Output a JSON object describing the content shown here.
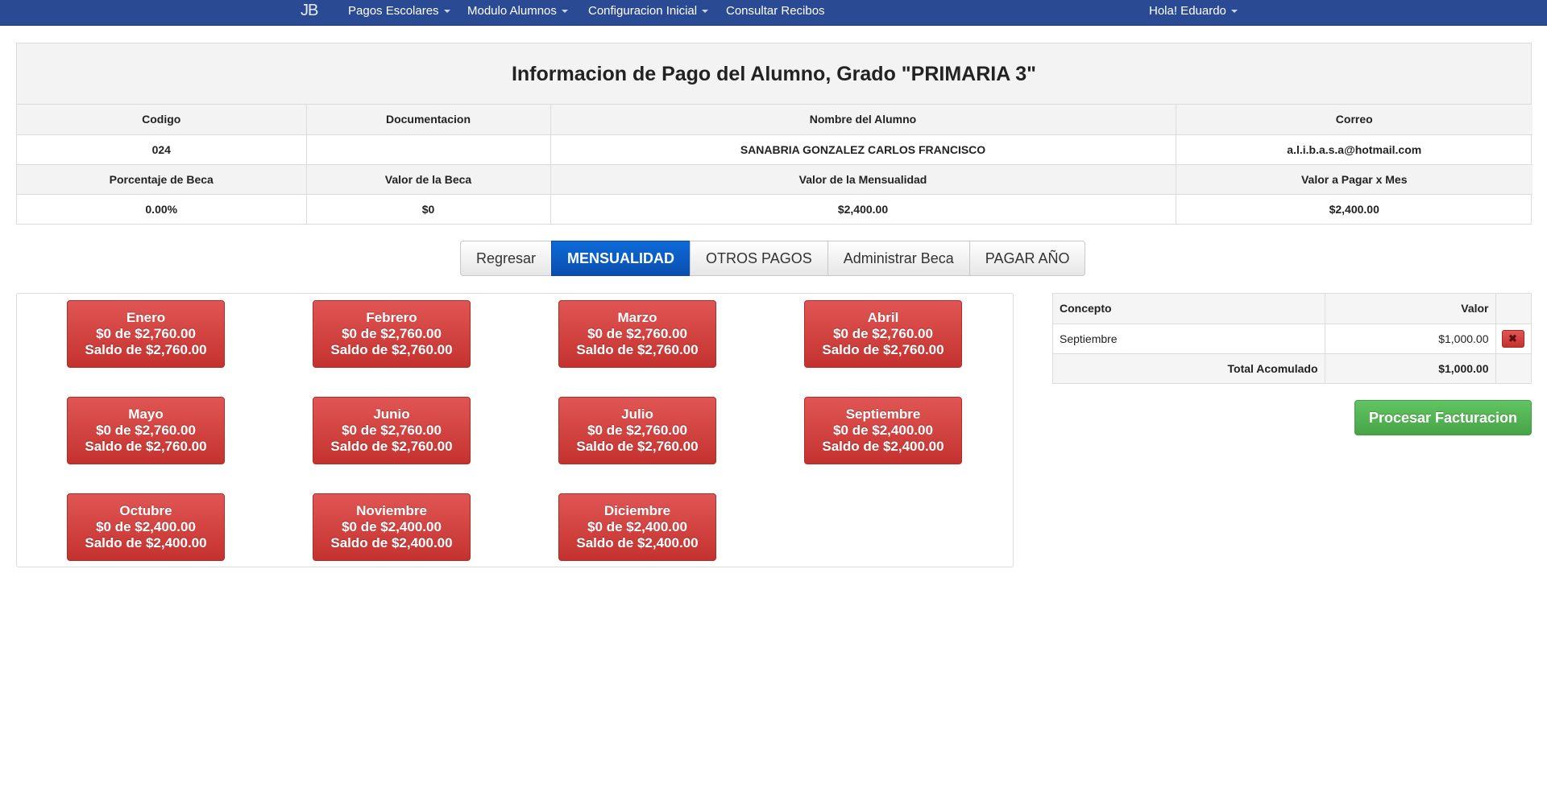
{
  "nav": {
    "brand": "JB",
    "items": [
      {
        "label": "Pagos Escolares",
        "dropdown": true
      },
      {
        "label": "Modulo Alumnos",
        "dropdown": true
      },
      {
        "label": "Configuracion Inicial",
        "dropdown": true
      },
      {
        "label": "Consultar Recibos",
        "dropdown": false
      }
    ],
    "user": "Hola! Eduardo"
  },
  "info": {
    "title": "Informacion de Pago del Alumno, Grado \"PRIMARIA 3\"",
    "headers1": [
      "Codigo",
      "Documentacion",
      "Nombre del Alumno",
      "Correo"
    ],
    "values1": [
      "024",
      "",
      "SANABRIA GONZALEZ CARLOS FRANCISCO",
      "a.l.i.b.a.s.a@hotmail.com"
    ],
    "headers2": [
      "Porcentaje de Beca",
      "Valor de la Beca",
      "Valor de la Mensualidad",
      "Valor a Pagar x Mes"
    ],
    "values2": [
      "0.00%",
      "$0",
      "$2,400.00",
      "$2,400.00"
    ]
  },
  "tabs": {
    "items": [
      "Regresar",
      "MENSUALIDAD",
      "OTROS PAGOS",
      "Administrar Beca",
      "PAGAR AÑO"
    ],
    "active": "MENSUALIDAD"
  },
  "months": [
    {
      "name": "Enero",
      "paid": "$0 de $2,760.00",
      "balance": "Saldo de $2,760.00"
    },
    {
      "name": "Febrero",
      "paid": "$0 de $2,760.00",
      "balance": "Saldo de $2,760.00"
    },
    {
      "name": "Marzo",
      "paid": "$0 de $2,760.00",
      "balance": "Saldo de $2,760.00"
    },
    {
      "name": "Abril",
      "paid": "$0 de $2,760.00",
      "balance": "Saldo de $2,760.00"
    },
    {
      "name": "Mayo",
      "paid": "$0 de $2,760.00",
      "balance": "Saldo de $2,760.00"
    },
    {
      "name": "Junio",
      "paid": "$0 de $2,760.00",
      "balance": "Saldo de $2,760.00"
    },
    {
      "name": "Julio",
      "paid": "$0 de $2,760.00",
      "balance": "Saldo de $2,760.00"
    },
    {
      "name": "Septiembre",
      "paid": "$0 de $2,400.00",
      "balance": "Saldo de $2,400.00"
    },
    {
      "name": "Octubre",
      "paid": "$0 de $2,400.00",
      "balance": "Saldo de $2,400.00"
    },
    {
      "name": "Noviembre",
      "paid": "$0 de $2,400.00",
      "balance": "Saldo de $2,400.00"
    },
    {
      "name": "Diciembre",
      "paid": "$0 de $2,400.00",
      "balance": "Saldo de $2,400.00"
    }
  ],
  "concepts": {
    "headers": [
      "Concepto",
      "Valor"
    ],
    "rows": [
      {
        "concept": "Septiembre",
        "value": "$1,000.00",
        "delete_icon": "close-icon"
      }
    ],
    "total_label": "Total Acomulado",
    "total_value": "$1,000.00"
  },
  "process_button": "Procesar Facturacion",
  "colors": {
    "navbar": "#2b4a94",
    "active_tab": "#0a5ec6",
    "month_button": "#d2413e",
    "process_button": "#53b153"
  }
}
